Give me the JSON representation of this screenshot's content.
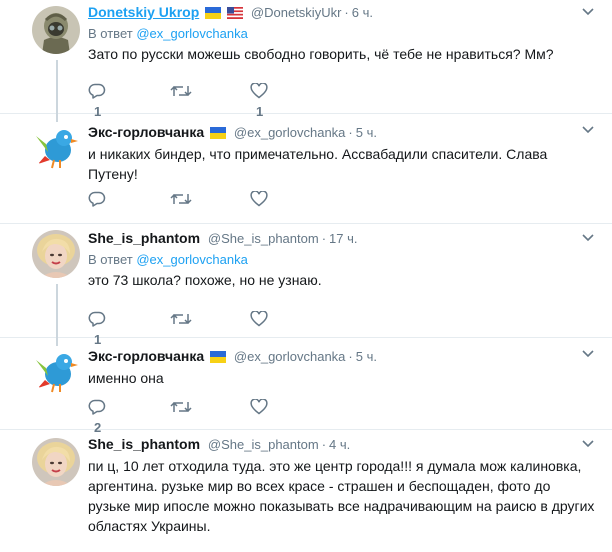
{
  "colors": {
    "link": "#1da1f2",
    "muted": "#657786",
    "divider": "#e6ecf0"
  },
  "tweets": [
    {
      "name": "Donetskiy Ukrop",
      "flags": "ua-us",
      "handle": "@DonetskiyUkr",
      "sep": "·",
      "time": "6 ч.",
      "reply_prefix": "В ответ",
      "reply_to": "@ex_gorlovchanka",
      "text": "Зато по русски можешь свободно говорить, чё тебе не нравиться? Мм?",
      "replies": "1",
      "retweets": "",
      "likes": "1",
      "avatar_icon": "helmet-avatar-icon"
    },
    {
      "name": "Экс-горловчанка",
      "flags": "ua",
      "handle": "@ex_gorlovchanka",
      "sep": "·",
      "time": "5 ч.",
      "text": "и никаких биндер, что примечательно. Ассвабадили спасители. Слава Путену!",
      "replies": "",
      "retweets": "",
      "likes": "",
      "avatar_icon": "blue-bird-avatar-icon"
    },
    {
      "name": "She_is_phantom",
      "handle": "@She_is_phantom",
      "sep": "·",
      "time": "17 ч.",
      "reply_prefix": "В ответ",
      "reply_to": "@ex_gorlovchanka",
      "text": "это 73 школа? похоже, но не узнаю.",
      "replies": "1",
      "retweets": "",
      "likes": "",
      "avatar_icon": "portrait-avatar-icon"
    },
    {
      "name": "Экс-горловчанка",
      "flags": "ua",
      "handle": "@ex_gorlovchanka",
      "sep": "·",
      "time": "5 ч.",
      "text": "именно она",
      "replies": "2",
      "retweets": "",
      "likes": "",
      "avatar_icon": "blue-bird-avatar-icon"
    },
    {
      "name": "She_is_phantom",
      "handle": "@She_is_phantom",
      "sep": "·",
      "time": "4 ч.",
      "text": "пи    ц, 10 лет отходила туда. это же центр города!!! я думала мож калиновка, аргентина. рузьке мир во всех красе - страшен и беспощаден, фото до рузьке мир ипосле можно показывать все надрачивающим на раисю в других областях Украины.",
      "replies": "",
      "retweets": "",
      "likes": "",
      "avatar_icon": "portrait-avatar-icon"
    }
  ]
}
